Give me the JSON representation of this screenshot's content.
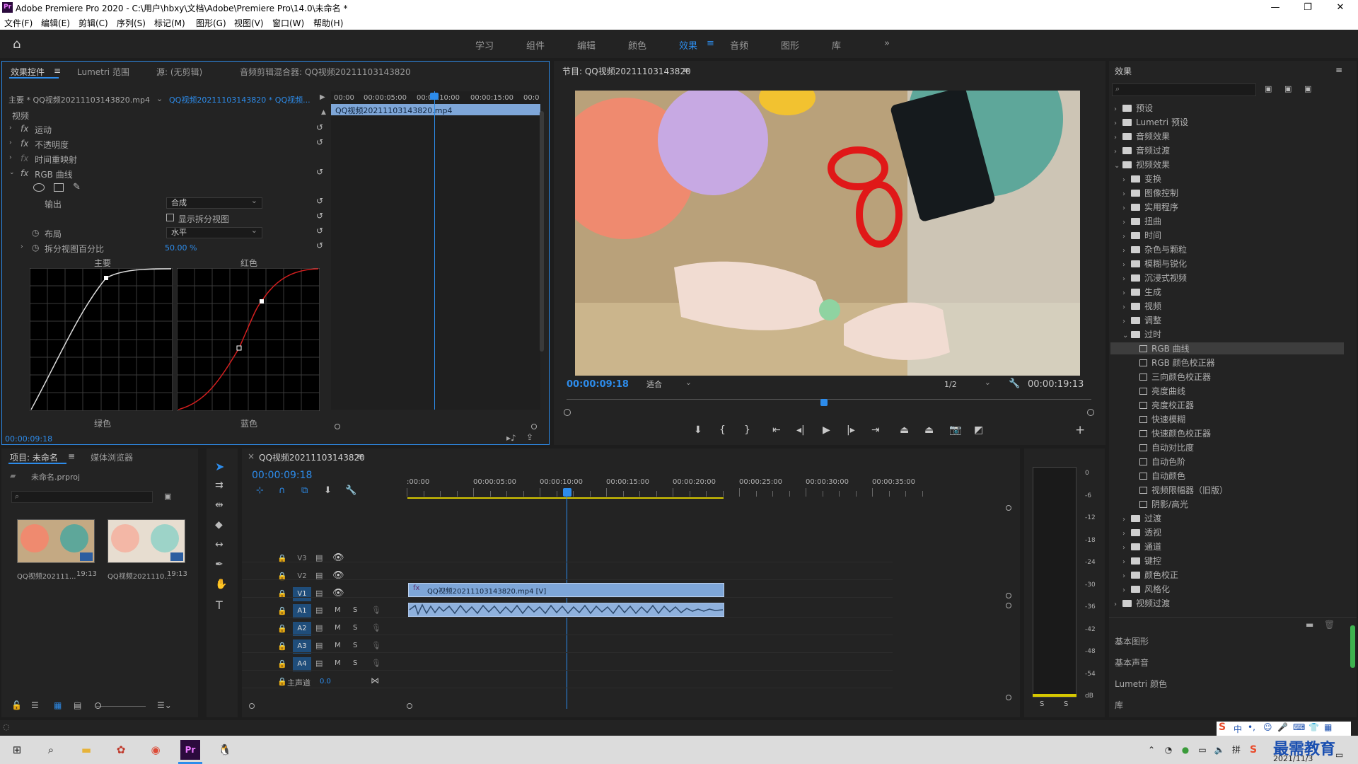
{
  "window": {
    "title": "Adobe Premiere Pro 2020 - C:\\用户\\hbxy\\文档\\Adobe\\Premiere Pro\\14.0\\未命名 *"
  },
  "menu": [
    "文件(F)",
    "编辑(E)",
    "剪辑(C)",
    "序列(S)",
    "标记(M)",
    "图形(G)",
    "视图(V)",
    "窗口(W)",
    "帮助(H)"
  ],
  "workspaces": [
    "学习",
    "组件",
    "编辑",
    "颜色",
    "效果",
    "音频",
    "图形",
    "库"
  ],
  "workspace_active": "效果",
  "effect_controls": {
    "tabs": [
      "效果控件",
      "Lumetri 范围",
      "源: (无剪辑)",
      "音频剪辑混合器: QQ视频20211103143820"
    ],
    "master_clip": "主要 * QQ视频20211103143820.mp4",
    "sequence_clip": "QQ视频20211103143820 * QQ视频...",
    "mini_ruler": [
      "00:00",
      "00:00:05:00",
      "00:00:10:00",
      "00:00:15:00",
      "00:0"
    ],
    "mini_clip": "QQ视频20211103143820.mp4",
    "section": "视频",
    "effects": [
      "运动",
      "不透明度",
      "时间重映射",
      "RGB 曲线"
    ],
    "output_label": "输出",
    "output_value": "合成",
    "split_label": "显示拆分视图",
    "layout_label": "布局",
    "layout_value": "水平",
    "split_pct_label": "拆分视图百分比",
    "split_pct_value": "50.00 %",
    "curve_labels": [
      "主要",
      "红色",
      "绿色",
      "蓝色"
    ],
    "timecode": "00:00:09:18"
  },
  "program": {
    "title": "节目: QQ视频20211103143820",
    "timecode": "00:00:09:18",
    "fit": "适合",
    "resolution": "1/2",
    "duration": "00:00:19:13"
  },
  "effects_panel": {
    "title": "效果",
    "items": [
      {
        "label": "预设",
        "level": 0,
        "type": "folder",
        "open": false
      },
      {
        "label": "Lumetri 预设",
        "level": 0,
        "type": "folder",
        "open": false
      },
      {
        "label": "音频效果",
        "level": 0,
        "type": "folder",
        "open": false
      },
      {
        "label": "音频过渡",
        "level": 0,
        "type": "folder",
        "open": false
      },
      {
        "label": "视频效果",
        "level": 0,
        "type": "folder",
        "open": true
      },
      {
        "label": "变换",
        "level": 1,
        "type": "folder",
        "open": false
      },
      {
        "label": "图像控制",
        "level": 1,
        "type": "folder",
        "open": false
      },
      {
        "label": "实用程序",
        "level": 1,
        "type": "folder",
        "open": false
      },
      {
        "label": "扭曲",
        "level": 1,
        "type": "folder",
        "open": false
      },
      {
        "label": "时间",
        "level": 1,
        "type": "folder",
        "open": false
      },
      {
        "label": "杂色与颗粒",
        "level": 1,
        "type": "folder",
        "open": false
      },
      {
        "label": "模糊与锐化",
        "level": 1,
        "type": "folder",
        "open": false
      },
      {
        "label": "沉浸式视频",
        "level": 1,
        "type": "folder",
        "open": false
      },
      {
        "label": "生成",
        "level": 1,
        "type": "folder",
        "open": false
      },
      {
        "label": "视频",
        "level": 1,
        "type": "folder",
        "open": false
      },
      {
        "label": "调整",
        "level": 1,
        "type": "folder",
        "open": false
      },
      {
        "label": "过时",
        "level": 1,
        "type": "folder",
        "open": true
      },
      {
        "label": "RGB 曲线",
        "level": 2,
        "type": "effect",
        "selected": true
      },
      {
        "label": "RGB 颜色校正器",
        "level": 2,
        "type": "effect"
      },
      {
        "label": "三向颜色校正器",
        "level": 2,
        "type": "effect"
      },
      {
        "label": "亮度曲线",
        "level": 2,
        "type": "effect"
      },
      {
        "label": "亮度校正器",
        "level": 2,
        "type": "effect"
      },
      {
        "label": "快速模糊",
        "level": 2,
        "type": "effect"
      },
      {
        "label": "快速颜色校正器",
        "level": 2,
        "type": "effect"
      },
      {
        "label": "自动对比度",
        "level": 2,
        "type": "effect"
      },
      {
        "label": "自动色阶",
        "level": 2,
        "type": "effect"
      },
      {
        "label": "自动颜色",
        "level": 2,
        "type": "effect"
      },
      {
        "label": "视频限幅器（旧版）",
        "level": 2,
        "type": "effect"
      },
      {
        "label": "阴影/高光",
        "level": 2,
        "type": "effect"
      },
      {
        "label": "过渡",
        "level": 1,
        "type": "folder",
        "open": false
      },
      {
        "label": "透视",
        "level": 1,
        "type": "folder",
        "open": false
      },
      {
        "label": "通道",
        "level": 1,
        "type": "folder",
        "open": false
      },
      {
        "label": "键控",
        "level": 1,
        "type": "folder",
        "open": false
      },
      {
        "label": "颜色校正",
        "level": 1,
        "type": "folder",
        "open": false
      },
      {
        "label": "风格化",
        "level": 1,
        "type": "folder",
        "open": false
      },
      {
        "label": "视频过渡",
        "level": 0,
        "type": "folder",
        "open": false
      }
    ],
    "bottom_sections": [
      "基本图形",
      "基本声音",
      "Lumetri 颜色",
      "库"
    ]
  },
  "project": {
    "tabs": [
      "项目: 未命名",
      "媒体浏览器"
    ],
    "file": "未命名.prproj",
    "clips": [
      {
        "name": "QQ视频202111...",
        "duration": "19:13"
      },
      {
        "name": "QQ视频2021110...",
        "duration": "19:13"
      }
    ]
  },
  "timeline": {
    "tab": "QQ视频20211103143820",
    "timecode": "00:00:09:18",
    "ruler": [
      ":00:00",
      "00:00:05:00",
      "00:00:10:00",
      "00:00:15:00",
      "00:00:20:00",
      "00:00:25:00",
      "00:00:30:00",
      "00:00:35:00"
    ],
    "video_tracks": [
      "V3",
      "V2",
      "V1"
    ],
    "audio_tracks": [
      "A1",
      "A2",
      "A3",
      "A4"
    ],
    "master_label": "主声道",
    "master_value": "0.0",
    "video_clip": "QQ视频20211103143820.mp4 [V]",
    "track_m": "M",
    "track_s": "S"
  },
  "meter": {
    "scale": [
      "0",
      "-6",
      "-12",
      "-18",
      "-24",
      "-30",
      "-36",
      "-42",
      "-48",
      "-54",
      "dB"
    ],
    "solo": [
      "S",
      "S"
    ]
  },
  "taskbar": {
    "date": "2021/11/3",
    "ime": "中",
    "watermark": "最需教育"
  },
  "colors": {
    "accent": "#2d8ceb",
    "panel": "#232323",
    "clip_video": "#7ea6d8",
    "clip_audio": "#8fb1dd"
  }
}
